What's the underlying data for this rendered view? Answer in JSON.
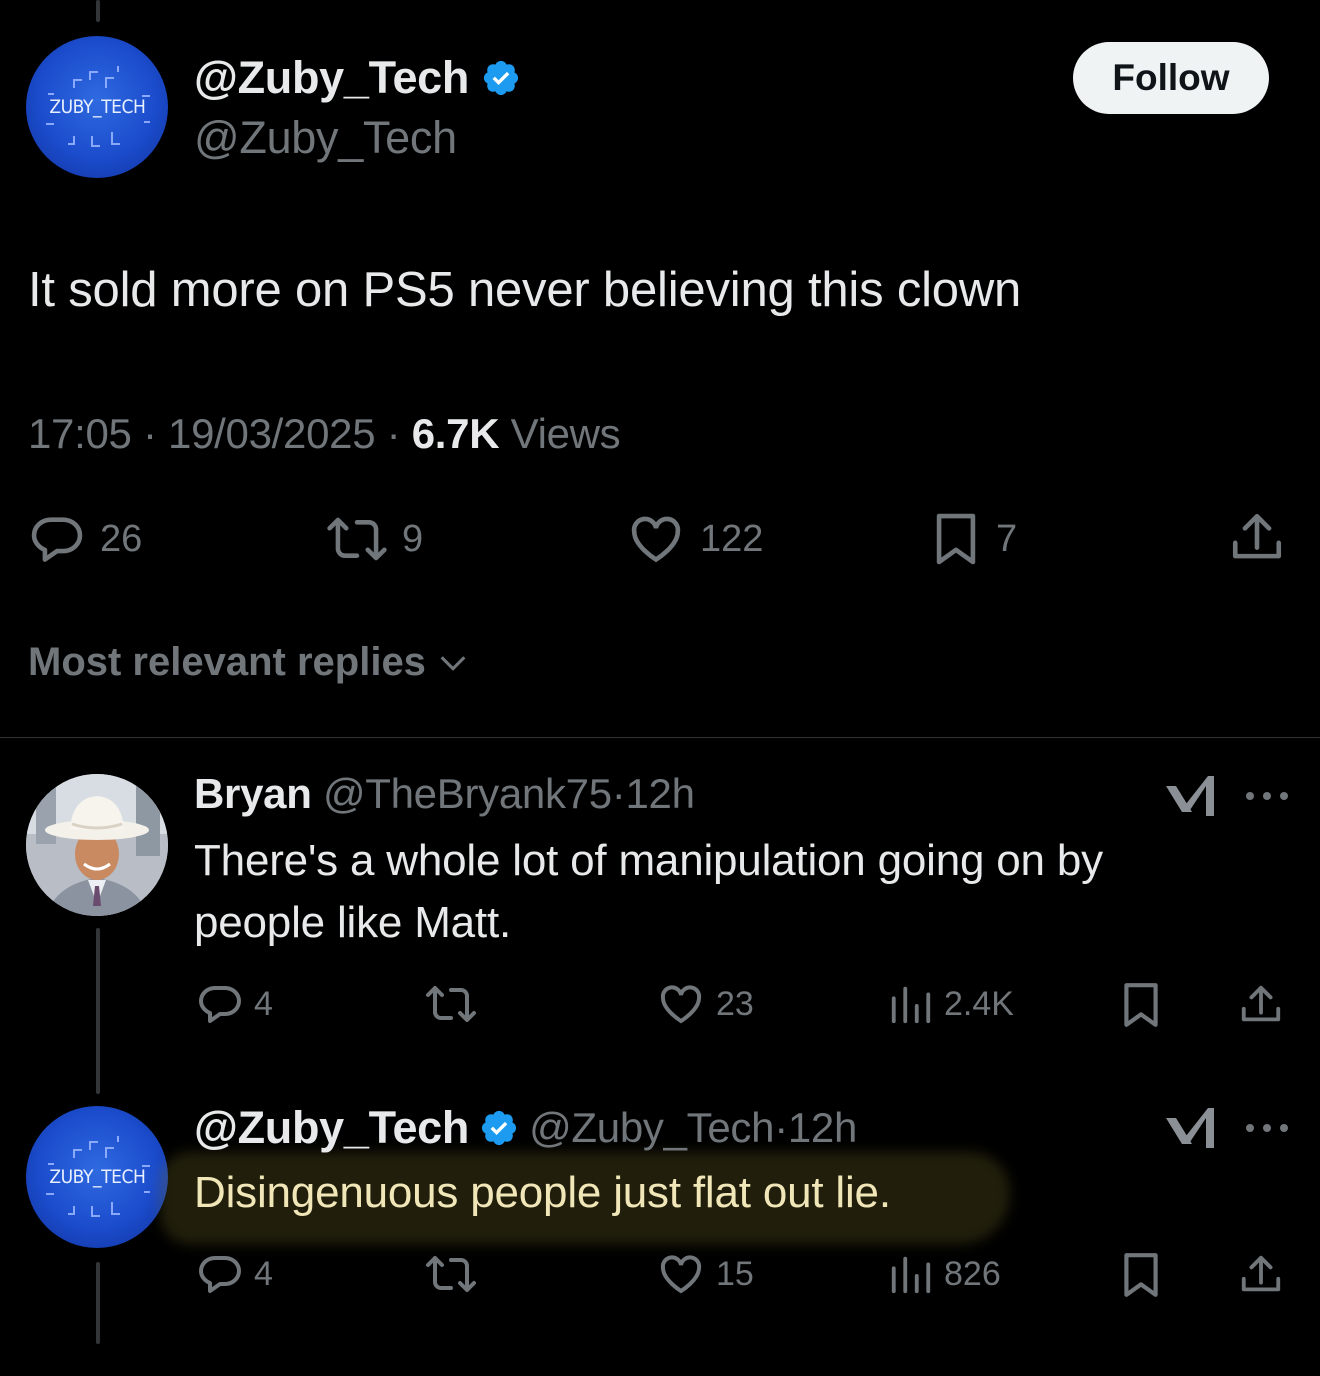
{
  "main_tweet": {
    "display_name": "@Zuby_Tech",
    "handle": "@Zuby_Tech",
    "avatar_text": "ZUBY_TECH",
    "follow_label": "Follow",
    "text": "It sold more on PS5 never believing this clown",
    "time": "17:05",
    "date": "19/03/2025",
    "views_count": "6.7K",
    "views_label": "Views",
    "separator": " · ",
    "actions": {
      "replies": "26",
      "reposts": "9",
      "likes": "122",
      "bookmarks": "7"
    }
  },
  "replies_filter": "Most relevant replies",
  "replies": [
    {
      "display_name": "Bryan",
      "handle": "@TheBryank75",
      "time": "12h",
      "text_line1": "There's a whole lot of manipulation going on by",
      "text_line2": "people like Matt.",
      "actions": {
        "replies": "4",
        "reposts": "",
        "likes": "23",
        "views": "2.4K"
      }
    },
    {
      "display_name": "@Zuby_Tech",
      "handle": "@Zuby_Tech",
      "time": "12h",
      "avatar_text": "ZUBY_TECH",
      "text_line1": "Disingenuous people just flat out lie.",
      "actions": {
        "replies": "4",
        "reposts": "",
        "likes": "15",
        "views": "826"
      }
    }
  ],
  "icons": {
    "verified_color": "#1d9bf0",
    "muted_color": "#71767b"
  }
}
